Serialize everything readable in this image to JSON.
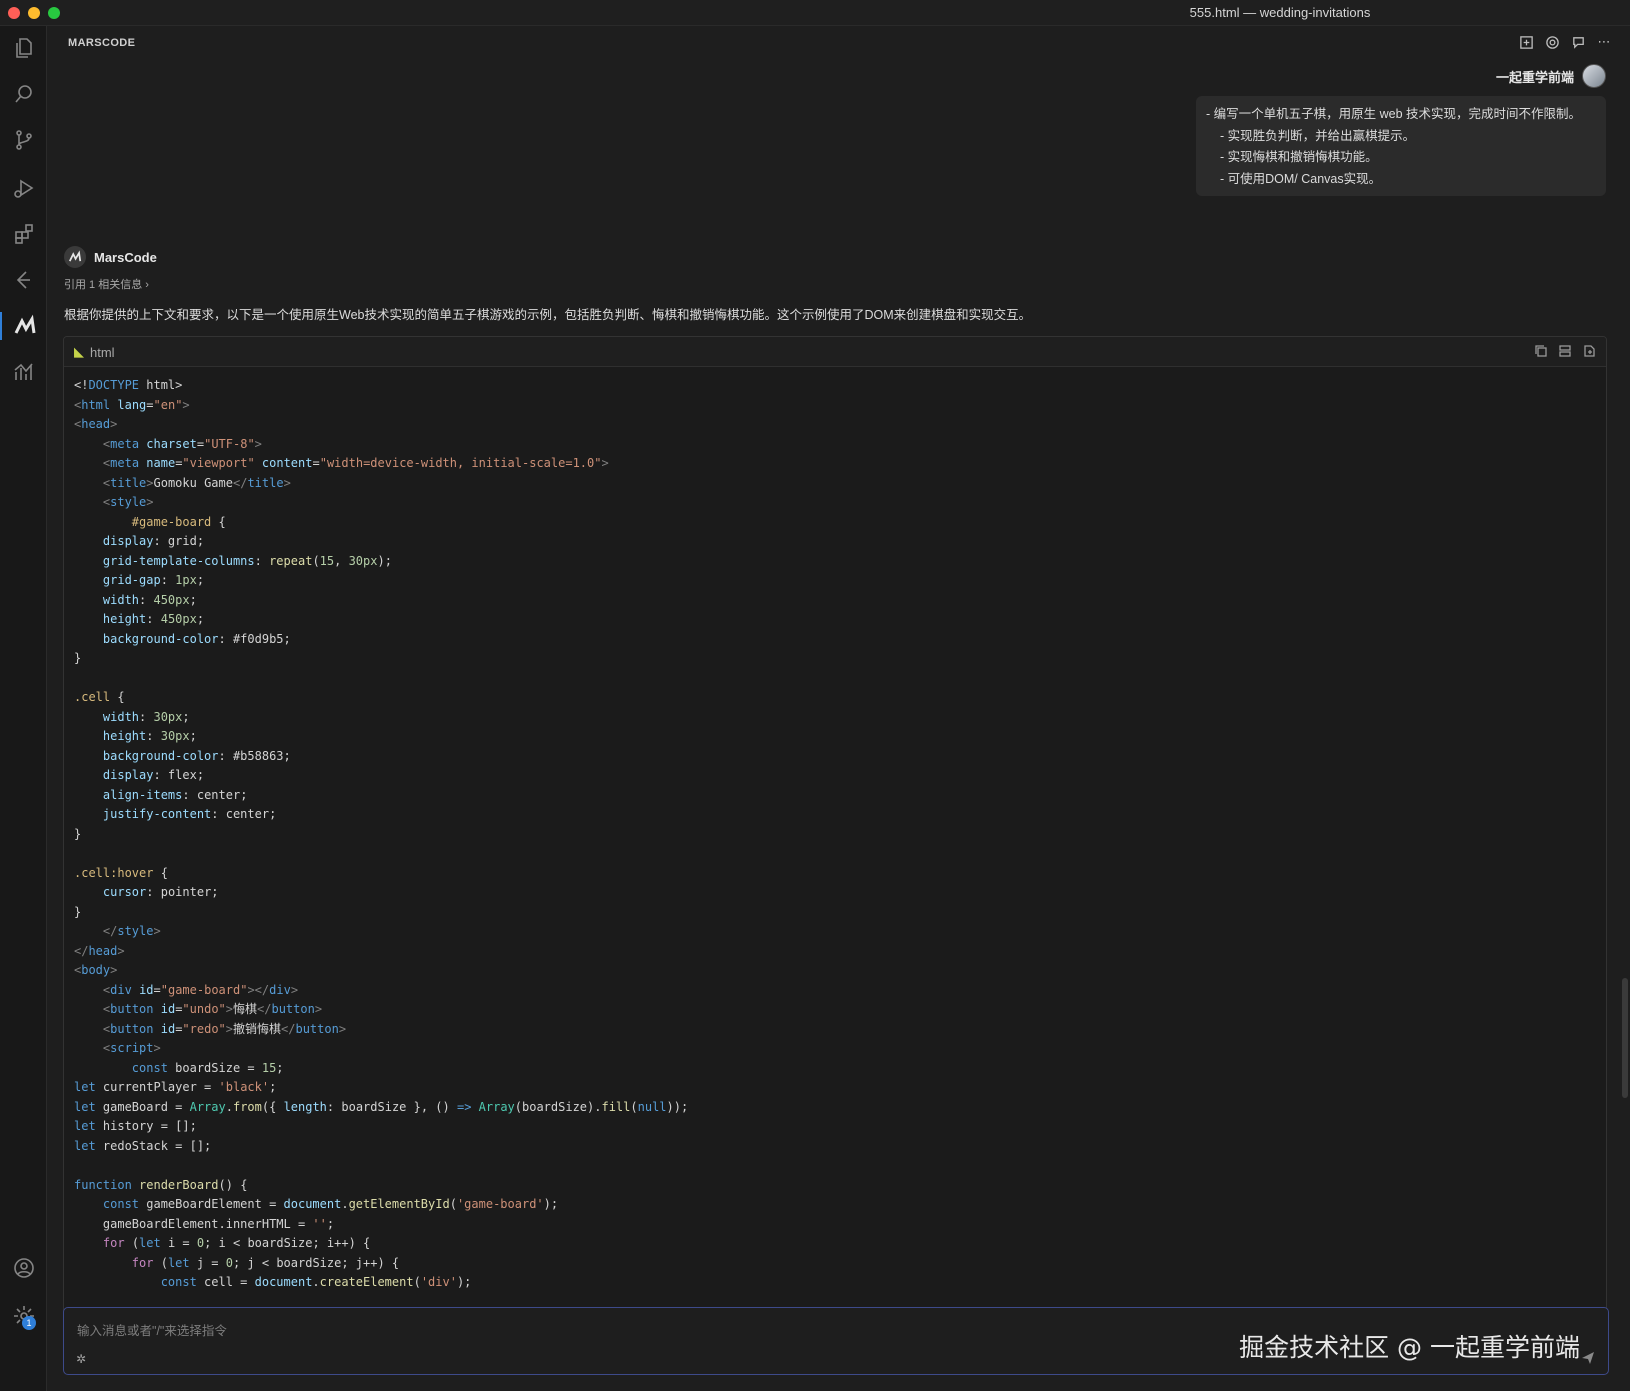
{
  "window": {
    "title": "555.html — wedding-invitations"
  },
  "activity_bar": {
    "icons": [
      "files-icon",
      "search-icon",
      "source-control-icon",
      "run-debug-icon",
      "extensions-icon",
      "timeline-icon",
      "marscode-icon",
      "analytics-icon",
      "account-icon",
      "settings-icon"
    ],
    "settings_badge": "1"
  },
  "panel": {
    "title": "MARSCODE"
  },
  "user_message": {
    "name": "一起重学前端",
    "lines": [
      "- 编写一个单机五子棋，用原生 web 技术实现，完成时间不作限制。",
      "- 实现胜负判断，并给出赢棋提示。",
      "- 实现悔棋和撤销悔棋功能。",
      "- 可使用DOM/ Canvas实现。"
    ]
  },
  "assistant": {
    "name": "MarsCode",
    "ref": "引用 1 相关信息",
    "intro": "根据你提供的上下文和要求，以下是一个使用原生Web技术实现的简单五子棋游戏的示例，包括胜负判断、悔棋和撤销悔棋功能。这个示例使用了DOM来创建棋盘和实现交互。",
    "code_lang": "html"
  },
  "input": {
    "placeholder": "输入消息或者\"/\"来选择指令",
    "watermark": "掘金技术社区 @ 一起重学前端"
  },
  "accent": "#2f7fd9"
}
